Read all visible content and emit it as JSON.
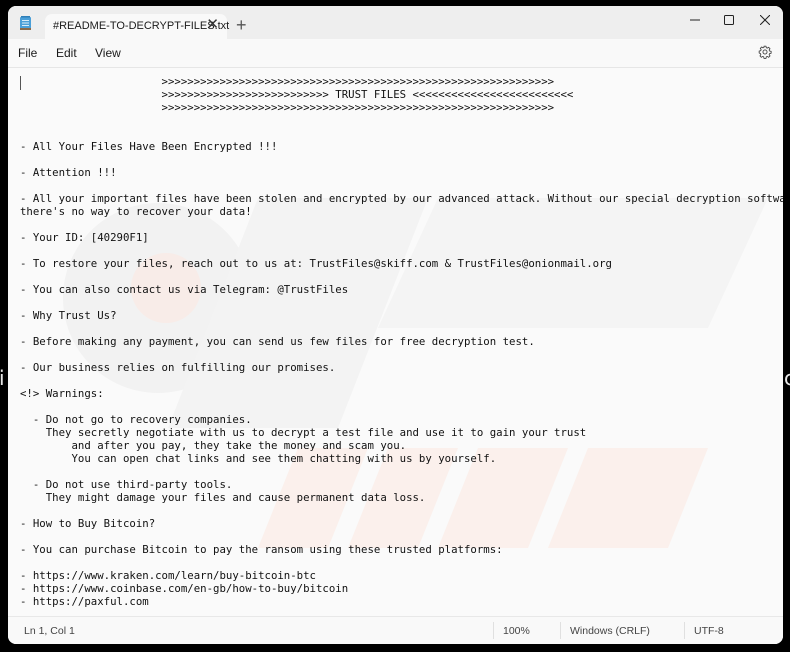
{
  "window": {
    "tab_title": "#README-TO-DECRYPT-FILES.txt",
    "close_tab_glyph": "✕",
    "new_tab_glyph": "+",
    "controls": {
      "minimize": "minimize-icon",
      "maximize": "maximize-icon",
      "close": "close-icon"
    }
  },
  "menu": {
    "file": "File",
    "edit": "Edit",
    "view": "View"
  },
  "editor": {
    "lines": [
      "                      >>>>>>>>>>>>>>>>>>>>>>>>>>>>>>>>>>>>>>>>>>>>>>>>>>>>>>>>>>>>>",
      "                      >>>>>>>>>>>>>>>>>>>>>>>>>> TRUST FILES <<<<<<<<<<<<<<<<<<<<<<<<<",
      "                      >>>>>>>>>>>>>>>>>>>>>>>>>>>>>>>>>>>>>>>>>>>>>>>>>>>>>>>>>>>>>",
      "",
      "",
      "- All Your Files Have Been Encrypted !!!",
      "",
      "- Attention !!!",
      "",
      "- All your important files have been stolen and encrypted by our advanced attack. Without our special decryption software,",
      "there's no way to recover your data!",
      "",
      "- Your ID: [40290F1]",
      "",
      "- To restore your files, reach out to us at: TrustFiles@skiff.com & TrustFiles@onionmail.org",
      "",
      "- You can also contact us via Telegram: @TrustFiles",
      "",
      "- Why Trust Us?",
      "",
      "- Before making any payment, you can send us few files for free decryption test.",
      "",
      "- Our business relies on fulfilling our promises.",
      "",
      "<!> Warnings:",
      "",
      "  - Do not go to recovery companies.",
      "    They secretly negotiate with us to decrypt a test file and use it to gain your trust",
      "        and after you pay, they take the money and scam you.",
      "        You can open chat links and see them chatting with us by yourself.",
      "",
      "  - Do not use third-party tools.",
      "    They might damage your files and cause permanent data loss.",
      "",
      "- How to Buy Bitcoin?",
      "",
      "- You can purchase Bitcoin to pay the ransom using these trusted platforms:",
      "",
      "- https://www.kraken.com/learn/buy-bitcoin-btc",
      "- https://www.coinbase.com/en-gb/how-to-buy/bitcoin",
      "- https://paxful.com"
    ]
  },
  "status": {
    "position": "Ln 1, Col 1",
    "zoom": "100%",
    "line_ending": "Windows (CRLF)",
    "encoding": "UTF-8"
  },
  "edge_text": {
    "left": "i",
    "right": "c"
  }
}
